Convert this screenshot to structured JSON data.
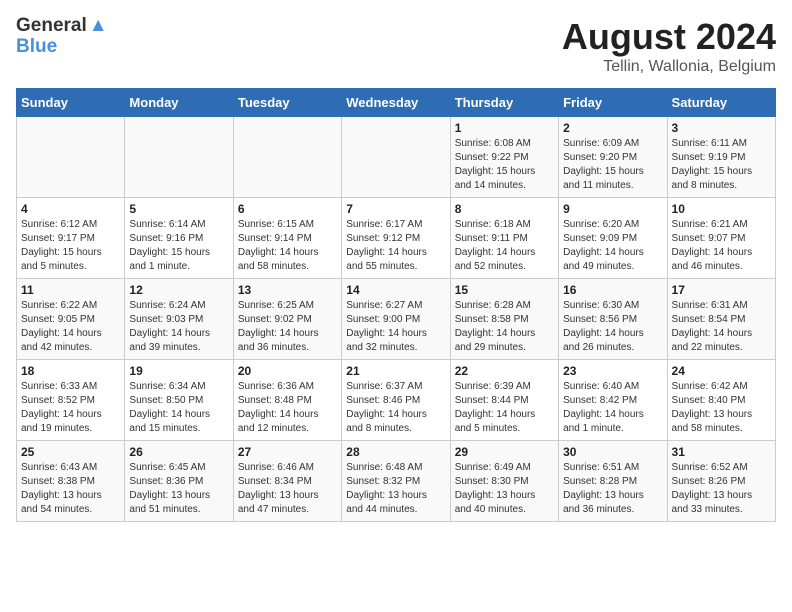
{
  "logo": {
    "line1": "General",
    "line2": "Blue"
  },
  "title": "August 2024",
  "subtitle": "Tellin, Wallonia, Belgium",
  "days_of_week": [
    "Sunday",
    "Monday",
    "Tuesday",
    "Wednesday",
    "Thursday",
    "Friday",
    "Saturday"
  ],
  "weeks": [
    [
      {
        "day": "",
        "empty": true
      },
      {
        "day": "",
        "empty": true
      },
      {
        "day": "",
        "empty": true
      },
      {
        "day": "",
        "empty": true
      },
      {
        "day": "1",
        "sunrise": "6:08 AM",
        "sunset": "9:22 PM",
        "daylight": "15 hours and 14 minutes."
      },
      {
        "day": "2",
        "sunrise": "6:09 AM",
        "sunset": "9:20 PM",
        "daylight": "15 hours and 11 minutes."
      },
      {
        "day": "3",
        "sunrise": "6:11 AM",
        "sunset": "9:19 PM",
        "daylight": "15 hours and 8 minutes."
      }
    ],
    [
      {
        "day": "4",
        "sunrise": "6:12 AM",
        "sunset": "9:17 PM",
        "daylight": "15 hours and 5 minutes."
      },
      {
        "day": "5",
        "sunrise": "6:14 AM",
        "sunset": "9:16 PM",
        "daylight": "15 hours and 1 minute."
      },
      {
        "day": "6",
        "sunrise": "6:15 AM",
        "sunset": "9:14 PM",
        "daylight": "14 hours and 58 minutes."
      },
      {
        "day": "7",
        "sunrise": "6:17 AM",
        "sunset": "9:12 PM",
        "daylight": "14 hours and 55 minutes."
      },
      {
        "day": "8",
        "sunrise": "6:18 AM",
        "sunset": "9:11 PM",
        "daylight": "14 hours and 52 minutes."
      },
      {
        "day": "9",
        "sunrise": "6:20 AM",
        "sunset": "9:09 PM",
        "daylight": "14 hours and 49 minutes."
      },
      {
        "day": "10",
        "sunrise": "6:21 AM",
        "sunset": "9:07 PM",
        "daylight": "14 hours and 46 minutes."
      }
    ],
    [
      {
        "day": "11",
        "sunrise": "6:22 AM",
        "sunset": "9:05 PM",
        "daylight": "14 hours and 42 minutes."
      },
      {
        "day": "12",
        "sunrise": "6:24 AM",
        "sunset": "9:03 PM",
        "daylight": "14 hours and 39 minutes."
      },
      {
        "day": "13",
        "sunrise": "6:25 AM",
        "sunset": "9:02 PM",
        "daylight": "14 hours and 36 minutes."
      },
      {
        "day": "14",
        "sunrise": "6:27 AM",
        "sunset": "9:00 PM",
        "daylight": "14 hours and 32 minutes."
      },
      {
        "day": "15",
        "sunrise": "6:28 AM",
        "sunset": "8:58 PM",
        "daylight": "14 hours and 29 minutes."
      },
      {
        "day": "16",
        "sunrise": "6:30 AM",
        "sunset": "8:56 PM",
        "daylight": "14 hours and 26 minutes."
      },
      {
        "day": "17",
        "sunrise": "6:31 AM",
        "sunset": "8:54 PM",
        "daylight": "14 hours and 22 minutes."
      }
    ],
    [
      {
        "day": "18",
        "sunrise": "6:33 AM",
        "sunset": "8:52 PM",
        "daylight": "14 hours and 19 minutes."
      },
      {
        "day": "19",
        "sunrise": "6:34 AM",
        "sunset": "8:50 PM",
        "daylight": "14 hours and 15 minutes."
      },
      {
        "day": "20",
        "sunrise": "6:36 AM",
        "sunset": "8:48 PM",
        "daylight": "14 hours and 12 minutes."
      },
      {
        "day": "21",
        "sunrise": "6:37 AM",
        "sunset": "8:46 PM",
        "daylight": "14 hours and 8 minutes."
      },
      {
        "day": "22",
        "sunrise": "6:39 AM",
        "sunset": "8:44 PM",
        "daylight": "14 hours and 5 minutes."
      },
      {
        "day": "23",
        "sunrise": "6:40 AM",
        "sunset": "8:42 PM",
        "daylight": "14 hours and 1 minute."
      },
      {
        "day": "24",
        "sunrise": "6:42 AM",
        "sunset": "8:40 PM",
        "daylight": "13 hours and 58 minutes."
      }
    ],
    [
      {
        "day": "25",
        "sunrise": "6:43 AM",
        "sunset": "8:38 PM",
        "daylight": "13 hours and 54 minutes."
      },
      {
        "day": "26",
        "sunrise": "6:45 AM",
        "sunset": "8:36 PM",
        "daylight": "13 hours and 51 minutes."
      },
      {
        "day": "27",
        "sunrise": "6:46 AM",
        "sunset": "8:34 PM",
        "daylight": "13 hours and 47 minutes."
      },
      {
        "day": "28",
        "sunrise": "6:48 AM",
        "sunset": "8:32 PM",
        "daylight": "13 hours and 44 minutes."
      },
      {
        "day": "29",
        "sunrise": "6:49 AM",
        "sunset": "8:30 PM",
        "daylight": "13 hours and 40 minutes."
      },
      {
        "day": "30",
        "sunrise": "6:51 AM",
        "sunset": "8:28 PM",
        "daylight": "13 hours and 36 minutes."
      },
      {
        "day": "31",
        "sunrise": "6:52 AM",
        "sunset": "8:26 PM",
        "daylight": "13 hours and 33 minutes."
      }
    ]
  ],
  "labels": {
    "sunrise": "Sunrise:",
    "sunset": "Sunset:",
    "daylight": "Daylight:"
  }
}
